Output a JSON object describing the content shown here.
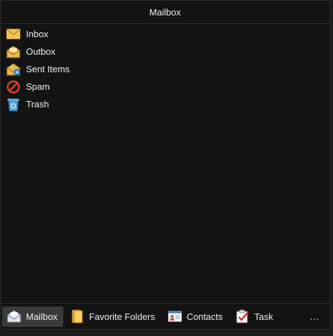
{
  "window": {
    "title": "Mailbox"
  },
  "folders": [
    {
      "label": "Inbox",
      "icon": "envelope-icon"
    },
    {
      "label": "Outbox",
      "icon": "outbox-envelope-icon"
    },
    {
      "label": "Sent Items",
      "icon": "sent-items-icon"
    },
    {
      "label": "Spam",
      "icon": "spam-icon"
    },
    {
      "label": "Trash",
      "icon": "trash-bin-icon"
    }
  ],
  "nav": {
    "items": [
      {
        "label": "Mailbox",
        "icon": "mailbox-icon",
        "active": true
      },
      {
        "label": "Favorite Folders",
        "icon": "favorite-folders-icon",
        "active": false
      },
      {
        "label": "Contacts",
        "icon": "contacts-icon",
        "active": false
      },
      {
        "label": "Task",
        "icon": "task-icon",
        "active": false
      }
    ],
    "more_label": "..."
  }
}
